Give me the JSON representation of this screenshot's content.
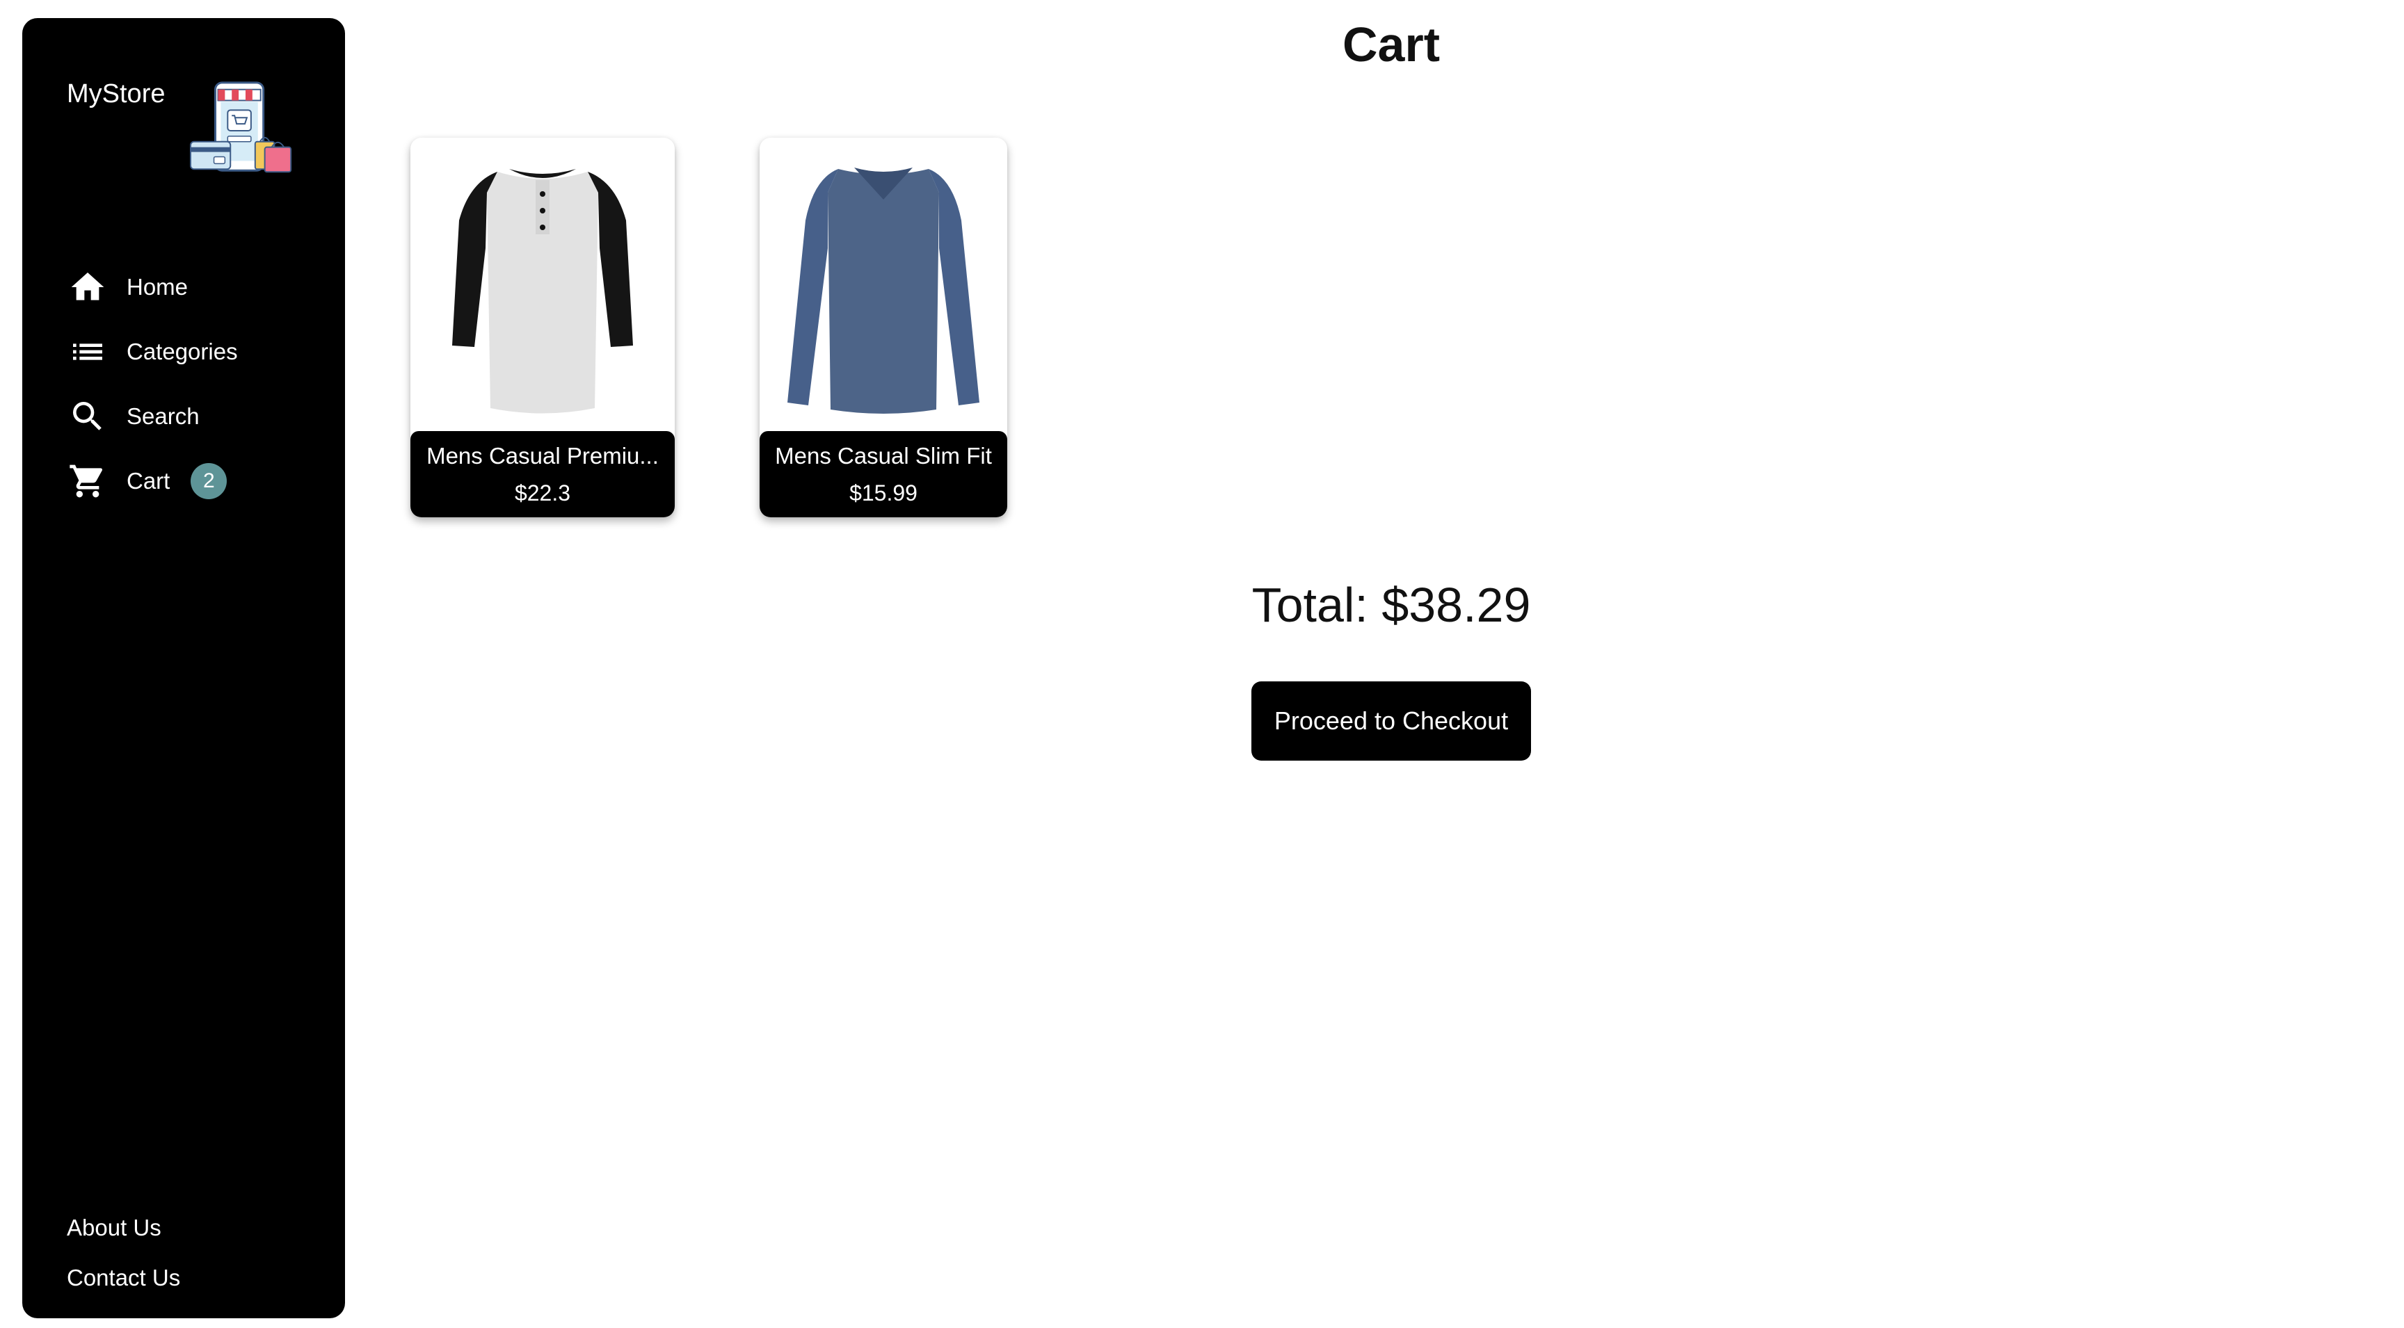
{
  "sidebar": {
    "brand_name": "MyStore",
    "logo_icon": "store-phone-shopping-illustration",
    "nav": [
      {
        "label": "Home",
        "icon": "home-icon"
      },
      {
        "label": "Categories",
        "icon": "list-icon"
      },
      {
        "label": "Search",
        "icon": "search-icon"
      },
      {
        "label": "Cart",
        "icon": "cart-icon",
        "badge": "2"
      }
    ],
    "footer": [
      {
        "label": "About Us"
      },
      {
        "label": "Contact Us"
      }
    ]
  },
  "main": {
    "title": "Cart",
    "items": [
      {
        "name": "Mens Casual Premiu...",
        "price": "$22.3",
        "image": "raglan-henley-shirt-grey-black"
      },
      {
        "name": "Mens Casual Slim Fit",
        "price": "$15.99",
        "image": "long-sleeve-vneck-shirt-blue"
      }
    ],
    "total": "Total: $38.29",
    "checkout_label": "Proceed to Checkout"
  },
  "colors": {
    "sidebar_bg": "#000000",
    "badge_bg": "#5e9497",
    "button_bg": "#000000",
    "text_dark": "#111111"
  }
}
